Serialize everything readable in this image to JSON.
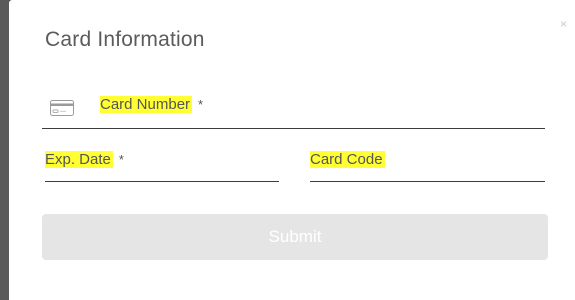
{
  "modal": {
    "close_label": "×",
    "title": "Card Information"
  },
  "fields": {
    "card_number": {
      "label": "Card Number",
      "required": "*",
      "icon": "credit-card-icon"
    },
    "exp_date": {
      "label": "Exp. Date",
      "required": "*"
    },
    "card_code": {
      "label": "Card Code"
    }
  },
  "actions": {
    "submit_label": "Submit"
  },
  "colors": {
    "highlight": "#ffff33",
    "submit_bg": "#e5e5e5",
    "title_text": "#5b5b5b"
  }
}
